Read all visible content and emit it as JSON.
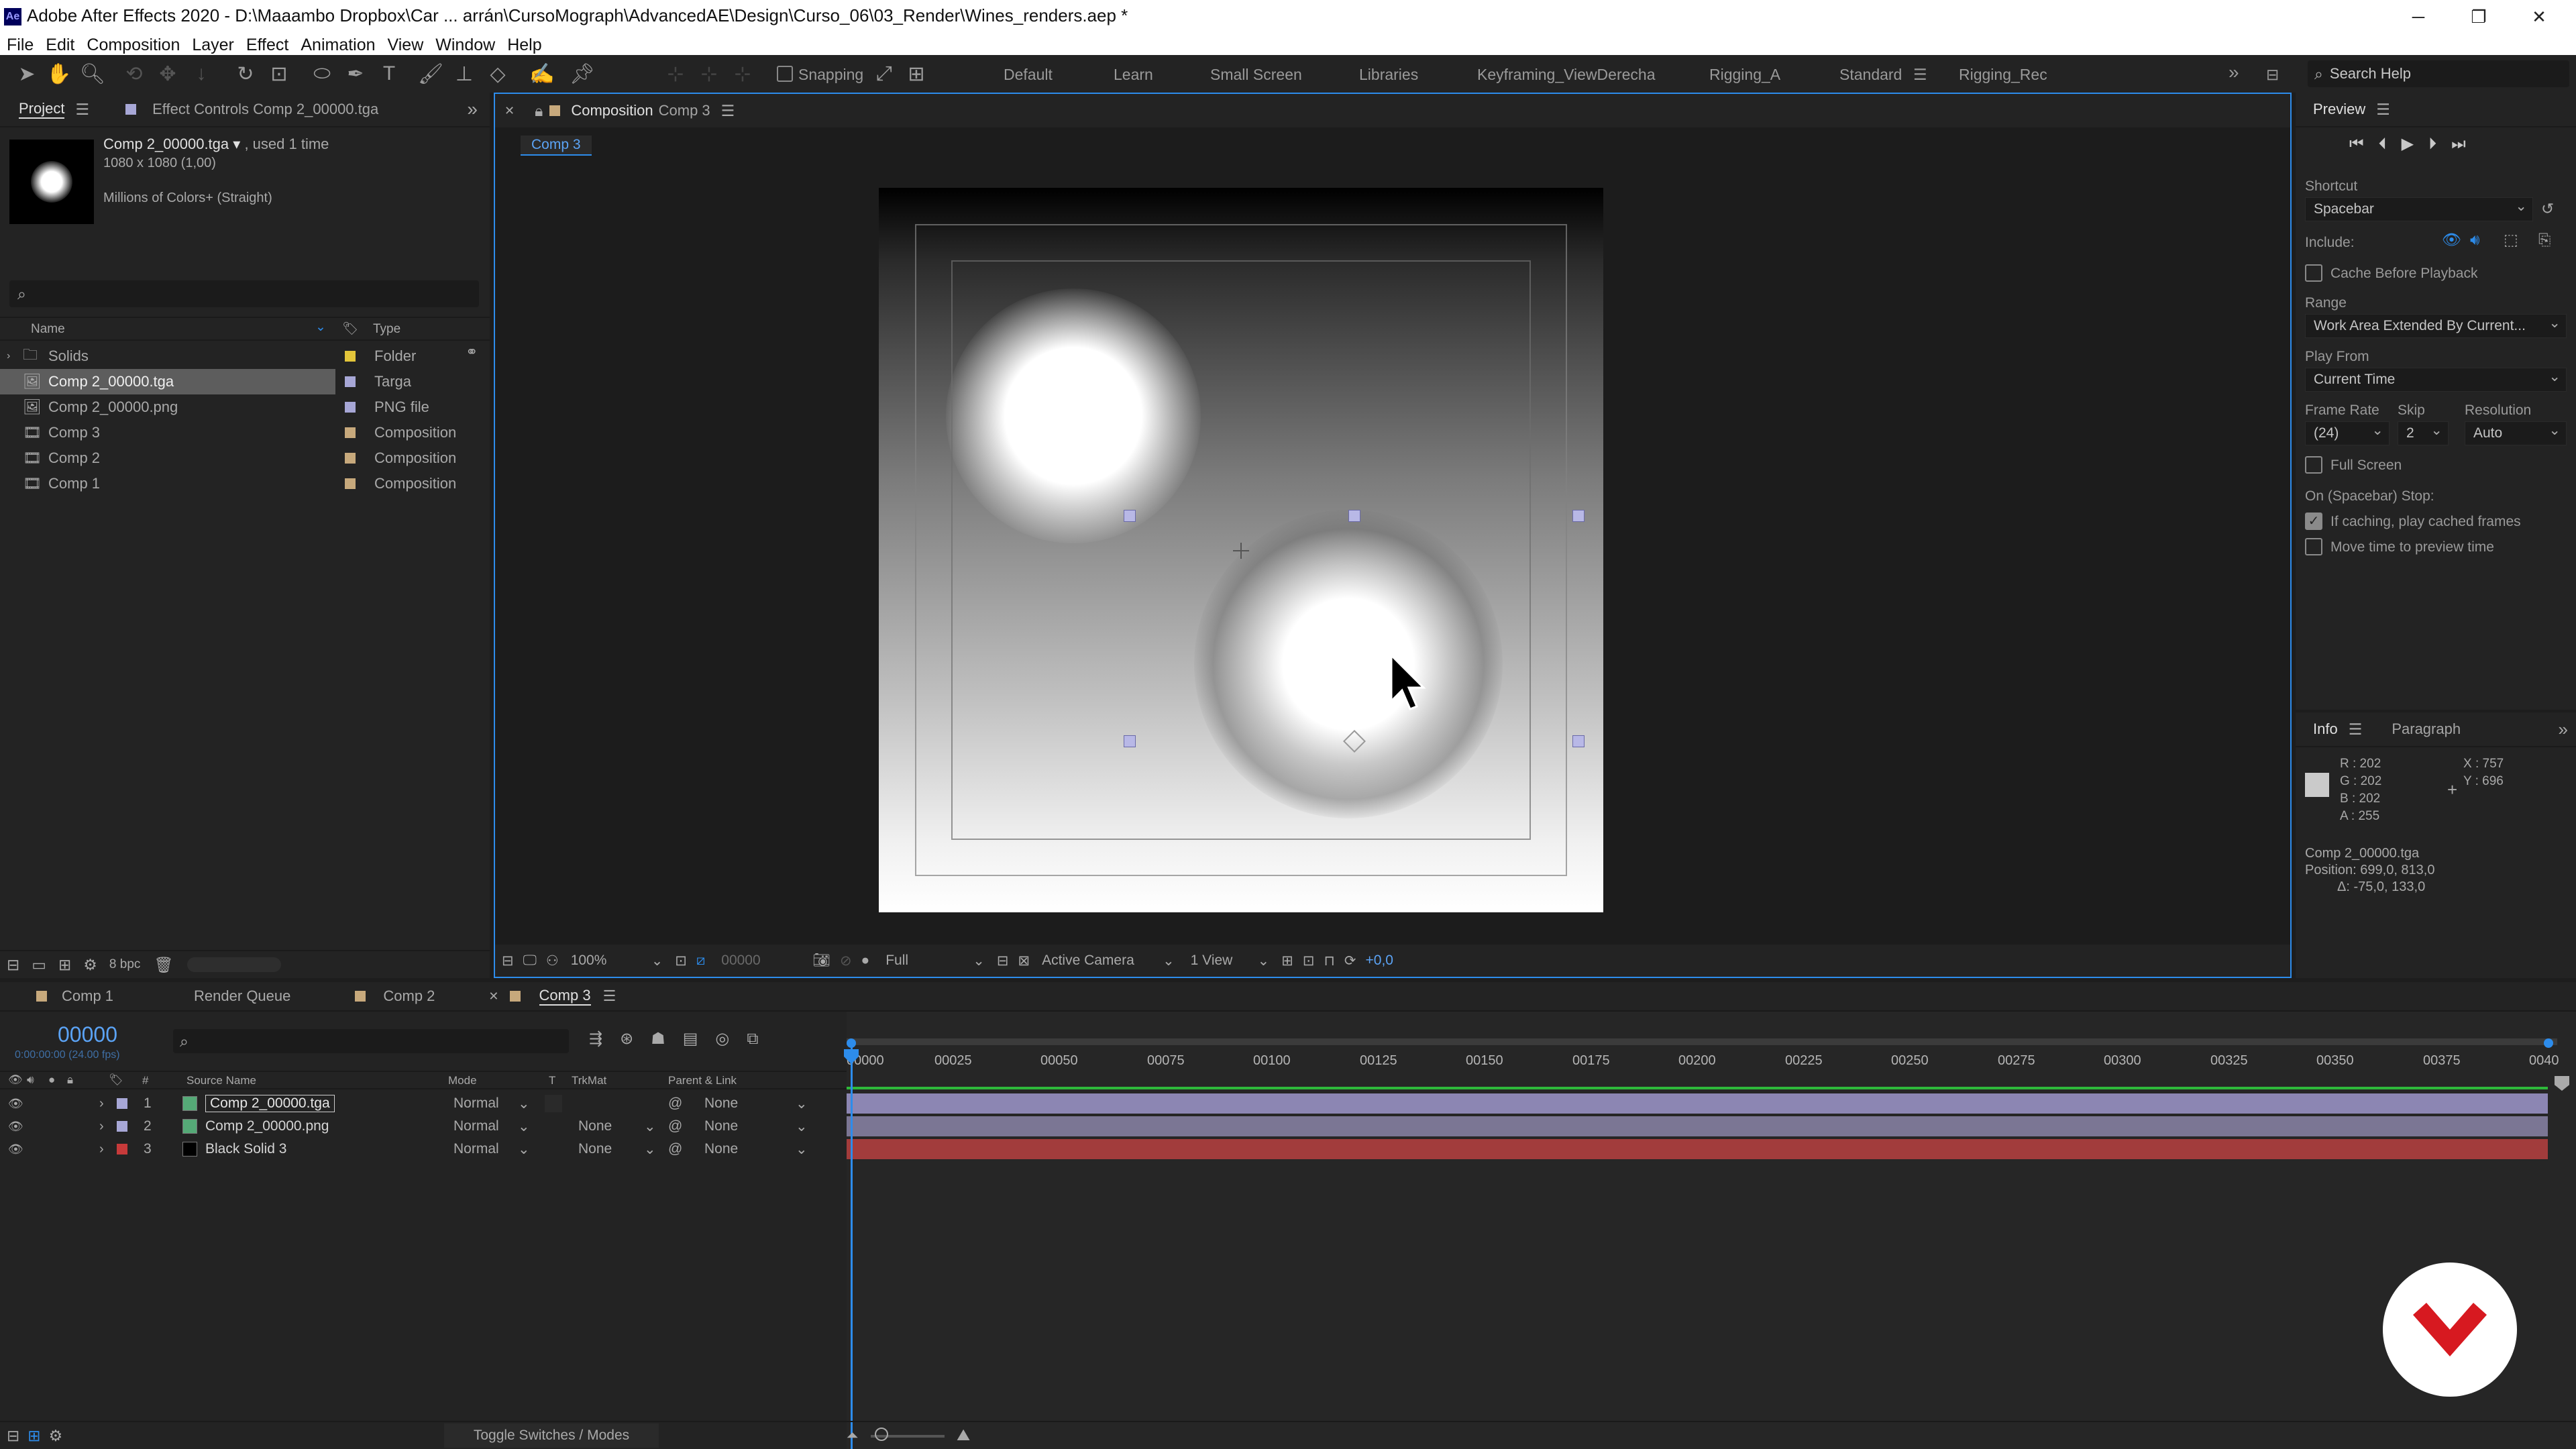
{
  "titlebar": {
    "app_badge": "Ae",
    "title": "Adobe After Effects 2020 - D:\\Maaambo Dropbox\\Car ... arrán\\CursoMograph\\AdvancedAE\\Design\\Curso_06\\03_Render\\Wines_renders.aep *"
  },
  "menu": [
    "File",
    "Edit",
    "Composition",
    "Layer",
    "Effect",
    "Animation",
    "View",
    "Window",
    "Help"
  ],
  "toolbar": {
    "snapping_label": "Snapping",
    "workspaces": [
      "Default",
      "Learn",
      "Small Screen",
      "Libraries",
      "Keyframing_ViewDerecha",
      "Rigging_A",
      "Standard",
      "Rigging_Rec"
    ],
    "active_workspace": "Standard",
    "search_placeholder": "Search Help"
  },
  "project": {
    "tab_project": "Project",
    "tab_effects": "Effect Controls Comp 2_00000.tga",
    "item_name": "Comp 2_00000.tga",
    "item_used": ", used 1 time",
    "item_dims": "1080 x 1080 (1,00)",
    "item_colors": "Millions of Colors+ (Straight)",
    "col_name": "Name",
    "col_type": "Type",
    "bpc": "8 bpc",
    "rows": [
      {
        "name": "Solids",
        "type": "Folder",
        "color": "#e3c53a",
        "icon": "folder-icon"
      },
      {
        "name": "Comp 2_00000.tga",
        "type": "Targa",
        "color": "#a7a7d6",
        "icon": "image-file-icon"
      },
      {
        "name": "Comp 2_00000.png",
        "type": "PNG file",
        "color": "#a7a7d6",
        "icon": "image-file-icon"
      },
      {
        "name": "Comp 3",
        "type": "Composition",
        "color": "#c7a97c",
        "icon": "composition-icon"
      },
      {
        "name": "Comp 2",
        "type": "Composition",
        "color": "#c7a97c",
        "icon": "composition-icon"
      },
      {
        "name": "Comp 1",
        "type": "Composition",
        "color": "#c7a97c",
        "icon": "composition-icon"
      }
    ]
  },
  "viewer": {
    "tab_label": "Composition",
    "tab_comp": "Comp 3",
    "breadcrumb": "Comp 3",
    "zoom": "100%",
    "timecode": "00000",
    "resolution": "Full",
    "camera": "Active Camera",
    "views": "1 View",
    "exposure": "+0,0"
  },
  "preview": {
    "title": "Preview",
    "shortcut_label": "Shortcut",
    "shortcut_value": "Spacebar",
    "include_label": "Include:",
    "cache_label": "Cache Before Playback",
    "range_label": "Range",
    "range_value": "Work Area Extended By Current...",
    "play_from_label": "Play From",
    "play_from_value": "Current Time",
    "frame_rate_label": "Frame Rate",
    "frame_rate_value": "(24)",
    "skip_label": "Skip",
    "skip_value": "2",
    "resolution_label": "Resolution",
    "resolution_value": "Auto",
    "full_screen_label": "Full Screen",
    "stop_label": "On (Spacebar) Stop:",
    "if_caching_label": "If caching, play cached frames",
    "move_time_label": "Move time to preview time"
  },
  "info": {
    "tab_info": "Info",
    "tab_paragraph": "Paragraph",
    "r": "R :  202",
    "g": "G :  202",
    "b": "B :  202",
    "a": "A :  255",
    "x": "X : 757",
    "y": "Y : 696",
    "layer": "Comp 2_00000.tga",
    "position": "Position: 699,0, 813,0",
    "delta": "Δ: -75,0, 133,0"
  },
  "timeline": {
    "tabs": [
      "Comp 1",
      "Render Queue",
      "Comp 2",
      "Comp 3"
    ],
    "current_time": "00000",
    "fps": "0:00:00:00 (24.00 fps)",
    "col_source": "Source Name",
    "col_mode": "Mode",
    "col_t": "T",
    "col_trkmat": "TrkMat",
    "col_parent": "Parent & Link",
    "ruler": [
      "00000",
      "00025",
      "00050",
      "00075",
      "00100",
      "00125",
      "00150",
      "00175",
      "00200",
      "00225",
      "00250",
      "00275",
      "00300",
      "00325",
      "00350",
      "00375",
      "0040"
    ],
    "layers": [
      {
        "num": "1",
        "name": "Comp 2_00000.tga",
        "mode": "Normal",
        "trkmat": "",
        "parent": "None",
        "color": "#a7a7d6"
      },
      {
        "num": "2",
        "name": "Comp 2_00000.png",
        "mode": "Normal",
        "trkmat": "None",
        "parent": "None",
        "color": "#a7a7d6"
      },
      {
        "num": "3",
        "name": "Black Solid 3",
        "mode": "Normal",
        "trkmat": "None",
        "parent": "None",
        "color": "#c73a3a"
      }
    ],
    "toggle_label": "Toggle Switches / Modes"
  }
}
